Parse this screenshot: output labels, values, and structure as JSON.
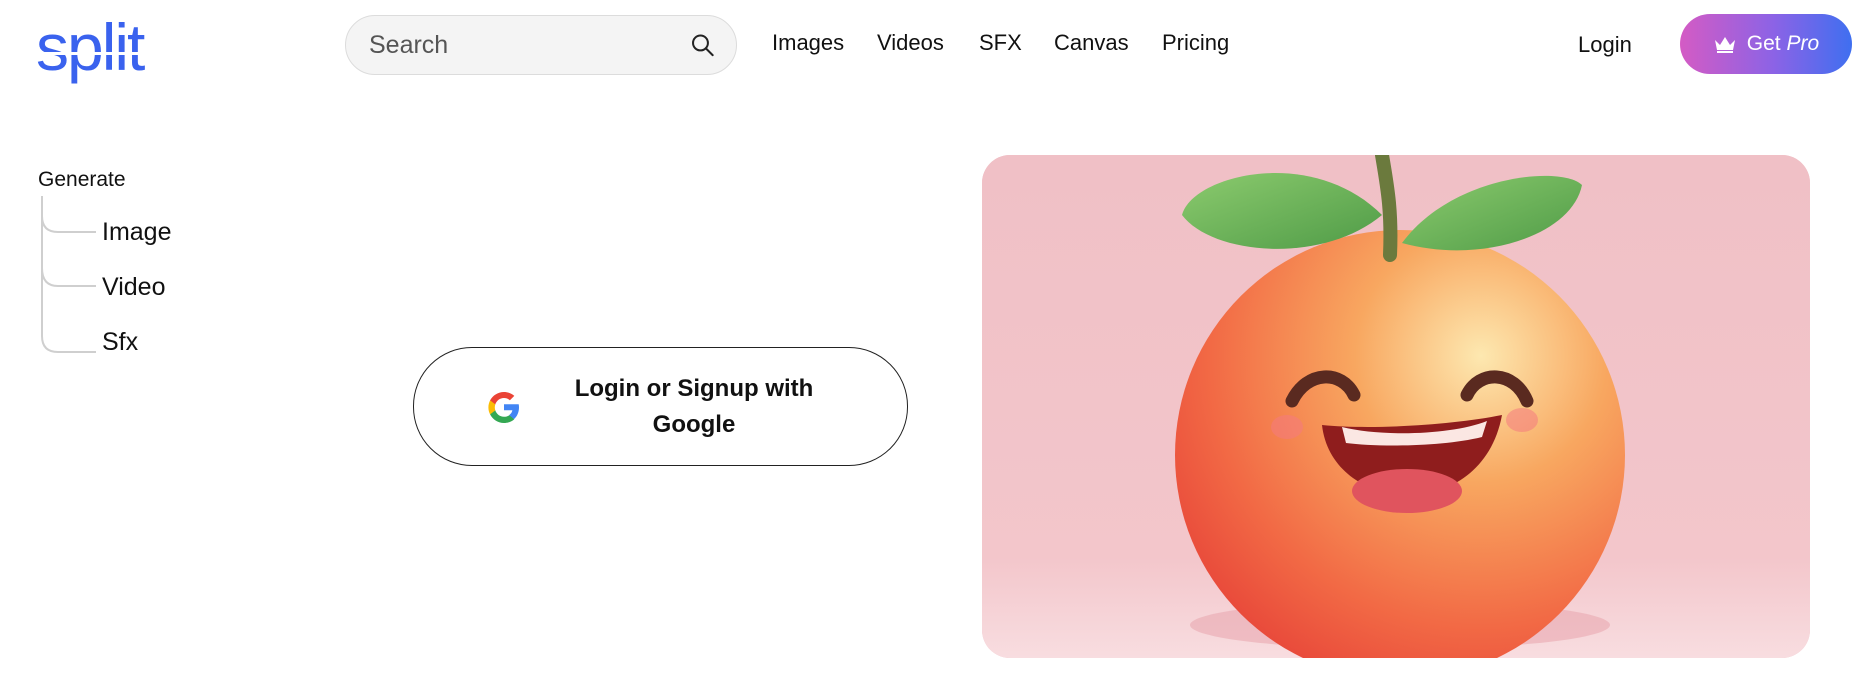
{
  "header": {
    "logo_text": "split",
    "search": {
      "placeholder": "Search",
      "value": ""
    },
    "nav": [
      "Images",
      "Videos",
      "SFX",
      "Canvas",
      "Pricing"
    ],
    "login_label": "Login",
    "get_pro": {
      "label": "Get",
      "emphasis": "Pro"
    }
  },
  "sidebar": {
    "title": "Generate",
    "items": [
      "Image",
      "Video",
      "Sfx"
    ]
  },
  "auth": {
    "google_line1": "Login or Signup with",
    "google_line2": "Google"
  },
  "hero": {
    "image": "smiling-orange-character-icon"
  },
  "colors": {
    "brand": "#3a62ee",
    "pro_gradient_start": "#d45bc4",
    "pro_gradient_end": "#3f6ff0",
    "hero_background": "#f2c3c9",
    "orange": "#f58a4e"
  }
}
